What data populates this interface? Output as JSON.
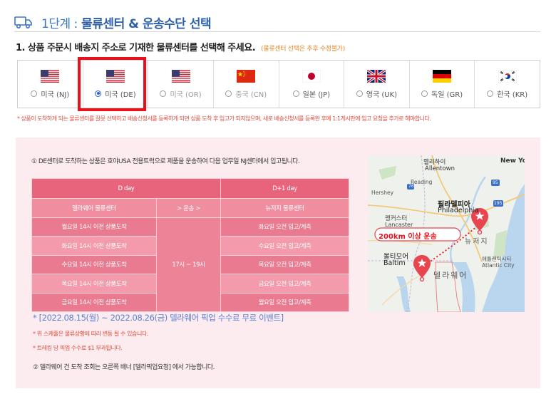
{
  "header": {
    "step": "1단계 :",
    "title": "물류센터 & 운송수단 선택",
    "icon": "truck-icon"
  },
  "instruction": {
    "main": "1. 상품 주문시 배송지 주소로 기재한 물류센터를 선택해 주세요.",
    "note": "(물류센터 선택은 추후 수정불가)"
  },
  "centers": [
    {
      "label": "미국 (NJ)",
      "flag": "us",
      "checked": false,
      "disabled": false
    },
    {
      "label": "미국 (DE)",
      "flag": "us",
      "checked": true,
      "disabled": false
    },
    {
      "label": "미국 (OR)",
      "flag": "us",
      "checked": false,
      "disabled": true
    },
    {
      "label": "중국 (CN)",
      "flag": "cn",
      "checked": false,
      "disabled": true
    },
    {
      "label": "일본 (JP)",
      "flag": "jp",
      "checked": false,
      "disabled": false
    },
    {
      "label": "영국 (UK)",
      "flag": "uk",
      "checked": false,
      "disabled": false
    },
    {
      "label": "독일 (GR)",
      "flag": "de",
      "checked": false,
      "disabled": false
    },
    {
      "label": "한국 (KR)",
      "flag": "kr",
      "checked": false,
      "disabled": false
    }
  ],
  "warning": "* 상품이 도착하게 되는 물류센터를 잘못 선택하고 배송신청서를 등록하게 되면 상품 도착 후 입고가 되지않으며, 새로 배송신청서를 등록한 후에 1:1게시판에 입고 요청을 추가로 해야합니다.",
  "panel": {
    "intro": "① DE센터로 도착하는 상품은 호야USA 전용트럭으로 제품을 운송하여 다음 업무일 NJ센터에서 입고됩니다.",
    "table": {
      "head_left": "D day",
      "head_right": "D+1 day",
      "sub_left": "델라웨어 물류센터",
      "sub_mid": "> 운송 >",
      "sub_right": "뉴저지 물류센터",
      "transport_time": "17시 ~ 19시",
      "rows": [
        {
          "left": "월요일 14시 이전 상품도착",
          "right": "화요일 오전 입고/계측"
        },
        {
          "left": "화요일 14시 이전 상품도착",
          "right": "수요일 오전 입고/계측"
        },
        {
          "left": "수요일 14시 이전 상품도착",
          "right": "목요일 오전 입고/계측"
        },
        {
          "left": "목요일 14시 이전 상품도착",
          "right": "금요일 오전 입고/계측"
        },
        {
          "left": "금요일 14시 이전 상품도착",
          "right": "월요일 오전 입고/계측"
        }
      ]
    },
    "event": "* [2022.08.15(월) ~ 2022.08.26(금) 델라웨어 픽업 수수료 무료 이벤트]",
    "note1": "* 위 스케쥴은 물류상황에 따라 변동 될 수 있습니다.",
    "note2": "* 트레킹 당 픽업 수수료 $1 부과됩니다.",
    "footer": "② 델라웨어 건 도착 조회는 오른쪽 배너 [델라픽업요청] 에서 가능합니다."
  },
  "map": {
    "distance_badge": "200km 이상 운송",
    "labels": {
      "lehigh": "렐리하이",
      "allentown": "Allentown",
      "newyork": "New Yo",
      "reading": "Reading",
      "hershey": "Hershey",
      "road_76": "76",
      "road_95": "95",
      "road_195": "195",
      "philly_kr": "필라델피아",
      "philly_en": "Philadelphia",
      "lancaster_kr": "랭커스터",
      "lancaster_en": "Lancaster",
      "nj_kr": "뉴저지",
      "baltimore_kr": "볼티모어",
      "baltimore_en": "Baltim",
      "atlantic_kr": "애틀랜틱시티",
      "atlantic_en": "Atlantic City",
      "delaware_kr": "델라웨어"
    }
  },
  "colors": {
    "accent_blue": "#2e5fa8",
    "highlight_red": "#e8121e",
    "panel_pink": "#fdecef",
    "table_pink": "#e7647c",
    "warn_red": "#e24c3c",
    "note_orange": "#e38a2e",
    "event_blue": "#5b7fd4"
  }
}
